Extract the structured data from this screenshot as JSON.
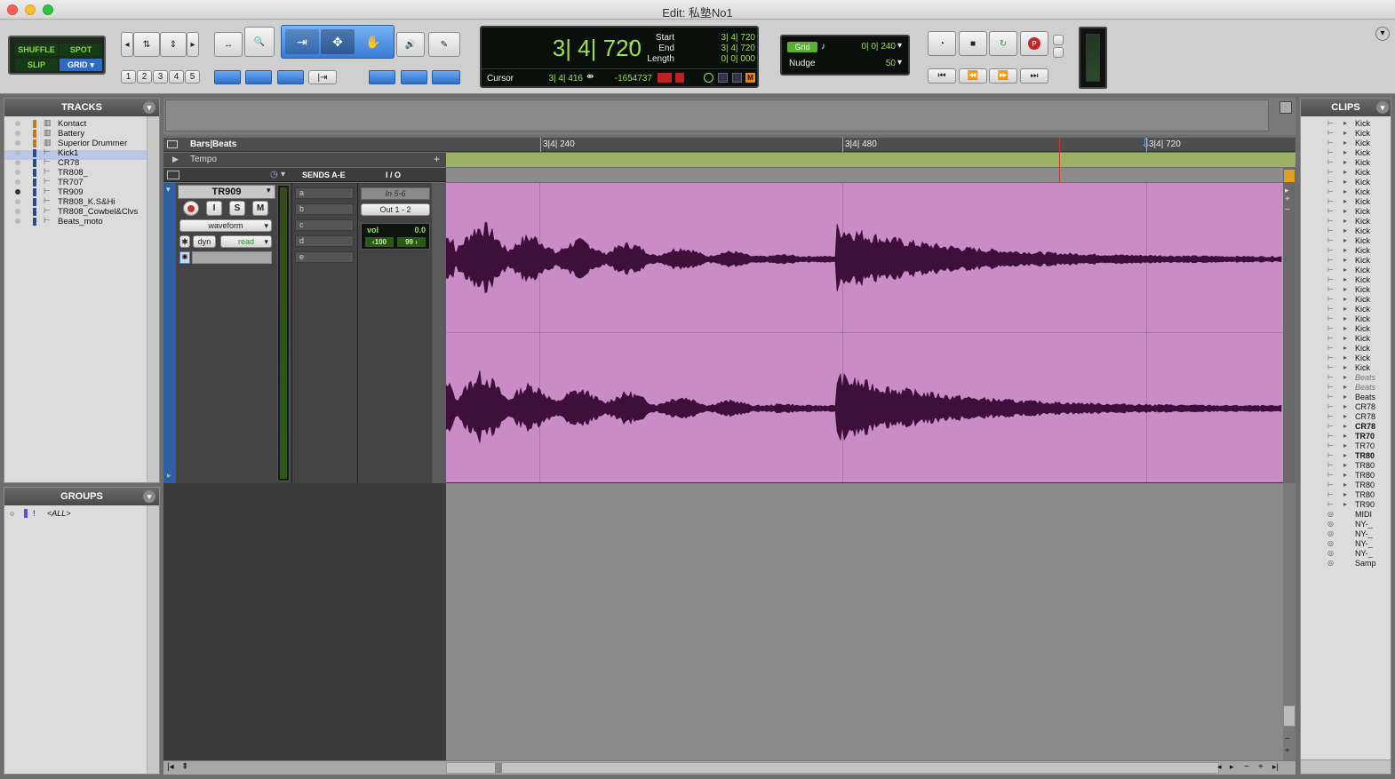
{
  "window": {
    "title": "Edit: 私塾No1"
  },
  "modes": {
    "shuffle": "SHUFFLE",
    "spot": "SPOT",
    "slip": "SLIP",
    "grid": "GRID"
  },
  "zoom_presets": [
    "1",
    "2",
    "3",
    "4",
    "5"
  ],
  "counter": {
    "main": "3| 4| 720",
    "start_label": "Start",
    "start": "3| 4| 720",
    "end_label": "End",
    "end": "3| 4| 720",
    "length_label": "Length",
    "length": "0| 0| 000",
    "cursor_label": "Cursor",
    "cursor": "3| 4| 416",
    "sample": "-1654737"
  },
  "grid": {
    "label": "Grid",
    "value": "0| 0| 240",
    "nudge_label": "Nudge",
    "nudge_value": "50"
  },
  "tracks_panel": {
    "title": "TRACKS",
    "items": [
      "Kontact",
      "Battery",
      "Superior Drummer",
      "Kick1",
      "CR78",
      "TR808_",
      "TR707",
      "TR909",
      "TR808_K.S&Hi",
      "TR808_Cowbel&Clvs",
      "Beats_moto"
    ],
    "selected": "Kick1"
  },
  "groups_panel": {
    "title": "GROUPS",
    "all": "<ALL>"
  },
  "ruler": {
    "label": "Bars|Beats",
    "marks": [
      "3|4| 240",
      "3|4| 480",
      "3|4| 720"
    ],
    "tempo_label": "Tempo"
  },
  "track": {
    "name": "TR909",
    "view": "waveform",
    "dyn": "dyn",
    "automation": "read",
    "sends_header": "SENDS A-E",
    "sends": [
      "a",
      "b",
      "c",
      "d",
      "e"
    ],
    "io_header": "I / O",
    "input": "In 5-6",
    "output": "Out 1 - 2",
    "vol_label": "vol",
    "vol_value": "0.0",
    "pan_left": "‹100",
    "pan_right": "99 ›",
    "buttons": {
      "input": "I",
      "solo": "S",
      "mute": "M"
    }
  },
  "clips_panel": {
    "title": "CLIPS",
    "items": [
      "Kick",
      "Kick",
      "Kick",
      "Kick",
      "Kick",
      "Kick",
      "Kick",
      "Kick",
      "Kick",
      "Kick",
      "Kick",
      "Kick",
      "Kick",
      "Kick",
      "Kick",
      "Kick",
      "Kick",
      "Kick",
      "Kick",
      "Kick",
      "Kick",
      "Kick",
      "Kick",
      "Kick",
      "Kick",
      "Kick",
      "Beats",
      "Beats",
      "Beats",
      "CR78",
      "CR78",
      "CR78",
      "TR70",
      "TR70",
      "TR80",
      "TR80",
      "TR80",
      "TR80",
      "TR80",
      "TR90",
      "MIDI",
      "NY-_",
      "NY-_",
      "NY-_",
      "NY-_",
      "Samp"
    ]
  },
  "colors": {
    "clip_bg": "#c98cc6",
    "waveform": "#3d0f3a",
    "tempo_bar": "#9cb067",
    "lcd_green": "#9ee04e",
    "accent_blue": "#3a7bd5"
  }
}
